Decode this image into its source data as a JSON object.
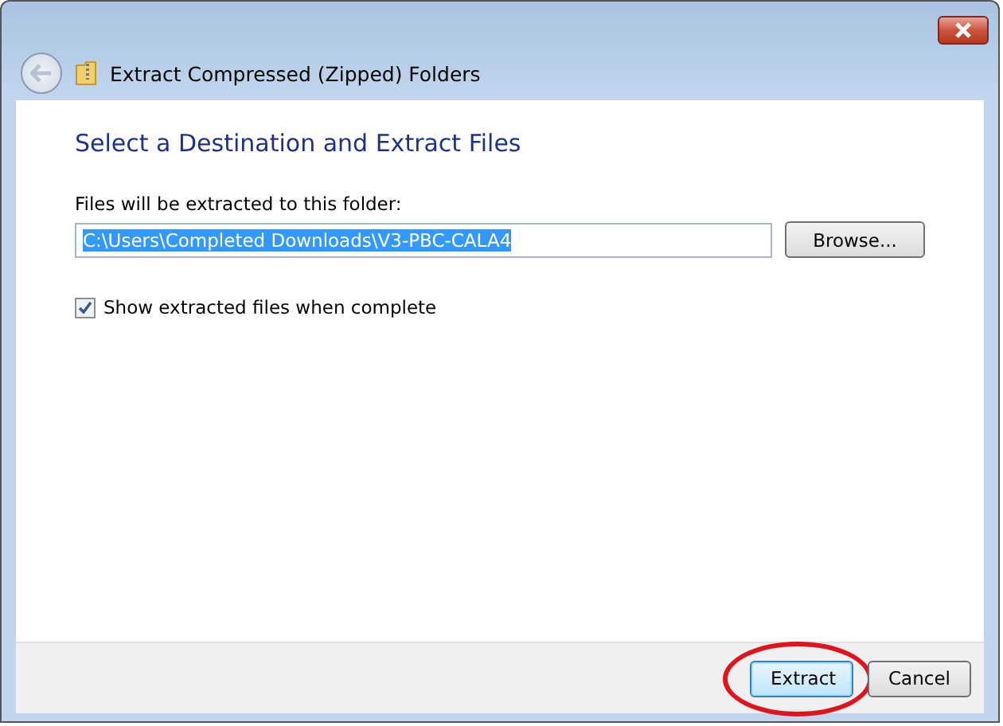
{
  "window": {
    "title": "Extract Compressed (Zipped) Folders"
  },
  "heading": "Select a Destination and Extract Files",
  "destination": {
    "label": "Files will be extracted to this folder:",
    "value": "C:\\Users\\Completed Downloads\\V3-PBC-CALA4",
    "value_selected": true
  },
  "browse_button": "Browse...",
  "show_files": {
    "label": "Show extracted files when complete",
    "checked": true
  },
  "buttons": [
    {
      "label": "Extract",
      "default": true,
      "circled": true
    },
    {
      "label": "Cancel",
      "default": false,
      "circled": false
    }
  ]
}
